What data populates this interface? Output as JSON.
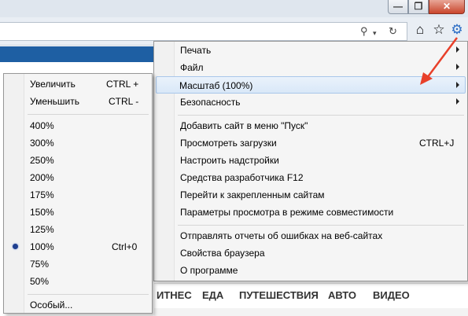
{
  "window_buttons": {
    "minimize": "—",
    "maximize": "❐",
    "close": "✕"
  },
  "toolbar": {
    "search_icon": "search-icon",
    "refresh_icon": "refresh-icon",
    "home_icon": "home-icon",
    "favorites_icon": "star-icon",
    "tools_icon": "gear-icon"
  },
  "page_nav": [
    "ИТНЕС",
    "ЕДА",
    "ПУТЕШЕСТВИЯ",
    "АВТО",
    "ВИДЕО"
  ],
  "tools_menu": {
    "items": [
      {
        "label": "Печать",
        "has_submenu": true
      },
      {
        "label": "Файл",
        "has_submenu": true
      },
      {
        "label": "Масштаб (100%)",
        "has_submenu": true,
        "highlighted": true
      },
      {
        "label": "Безопасность",
        "has_submenu": true
      },
      {
        "label": "Добавить сайт в меню \"Пуск\""
      },
      {
        "label": "Просмотреть загрузки",
        "shortcut": "CTRL+J"
      },
      {
        "label": "Настроить надстройки"
      },
      {
        "label": "Средства разработчика F12"
      },
      {
        "label": "Перейти к закрепленным сайтам"
      },
      {
        "label": "Параметры просмотра в режиме совместимости"
      },
      {
        "label": "Отправлять отчеты об ошибках на веб-сайтах"
      },
      {
        "label": "Свойства браузера"
      },
      {
        "label": "О программе"
      }
    ]
  },
  "zoom_menu": {
    "zoom_in": {
      "label": "Увеличить",
      "shortcut": "CTRL +"
    },
    "zoom_out": {
      "label": "Уменьшить",
      "shortcut": "CTRL -"
    },
    "levels": [
      {
        "label": "400%"
      },
      {
        "label": "300%"
      },
      {
        "label": "250%"
      },
      {
        "label": "200%"
      },
      {
        "label": "175%"
      },
      {
        "label": "150%"
      },
      {
        "label": "125%"
      },
      {
        "label": "100%",
        "shortcut": "Ctrl+0",
        "selected": true
      },
      {
        "label": "75%"
      },
      {
        "label": "50%"
      }
    ],
    "custom": {
      "label": "Особый..."
    }
  },
  "colors": {
    "annotation_arrow": "#e8402a",
    "accent_strip": "#1e5fa3",
    "highlight": "#d9e8f8"
  }
}
